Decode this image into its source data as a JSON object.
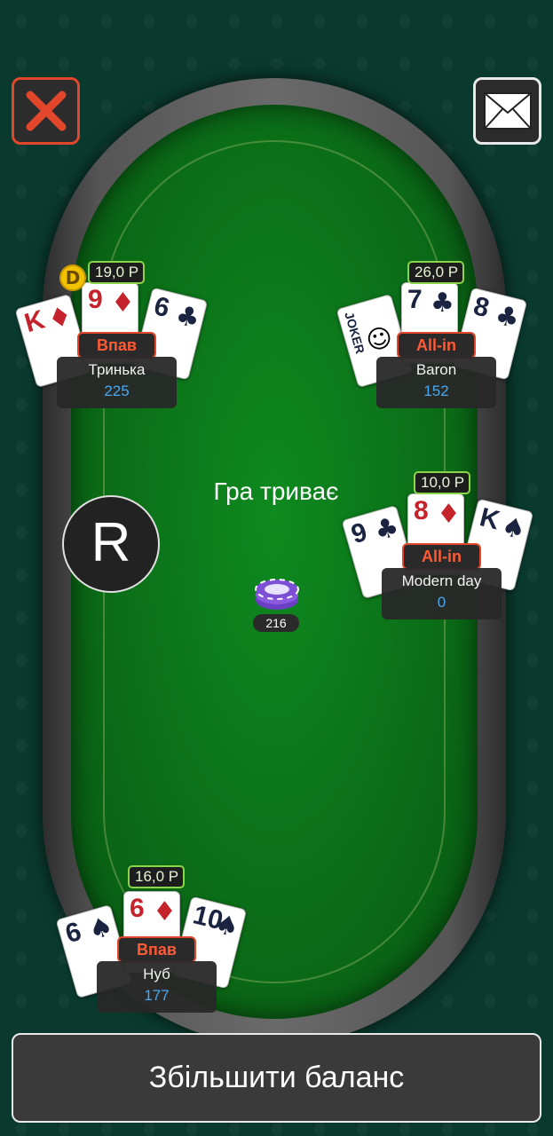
{
  "table": {
    "status_text": "Гра триває",
    "pot": "216",
    "r_button_label": "R"
  },
  "dealer_label": "D",
  "players": {
    "p1": {
      "name": "Тринька",
      "balance": "225",
      "bet": "19,0 Р",
      "status": "Впав",
      "cards": [
        {
          "rank": "K",
          "suit": "♦",
          "color": "red"
        },
        {
          "rank": "9",
          "suit": "♦",
          "color": "red"
        },
        {
          "rank": "6",
          "suit": "♣",
          "color": "black"
        }
      ]
    },
    "p2": {
      "name": "Baron",
      "balance": "152",
      "bet": "26,0 Р",
      "status": "All-in",
      "cards": [
        {
          "rank": "JOKER",
          "suit": "",
          "color": "black"
        },
        {
          "rank": "7",
          "suit": "♣",
          "color": "black"
        },
        {
          "rank": "8",
          "suit": "♣",
          "color": "black"
        }
      ]
    },
    "p3": {
      "name": "Modern day",
      "balance": "0",
      "bet": "10,0 Р",
      "status": "All-in",
      "cards": [
        {
          "rank": "9",
          "suit": "♣",
          "color": "black"
        },
        {
          "rank": "8",
          "suit": "♦",
          "color": "red"
        },
        {
          "rank": "K",
          "suit": "♠",
          "color": "black"
        }
      ]
    },
    "p4": {
      "name": "Нуб",
      "balance": "177",
      "bet": "16,0 Р",
      "status": "Впав",
      "cards": [
        {
          "rank": "6",
          "suit": "♠",
          "color": "black"
        },
        {
          "rank": "6",
          "suit": "♦",
          "color": "red"
        },
        {
          "rank": "10",
          "suit": "♠",
          "color": "black"
        }
      ]
    }
  },
  "buttons": {
    "add_balance": "Збільшити баланс",
    "close_icon": "close-icon",
    "mail_icon": "mail-icon"
  },
  "colors": {
    "accent_orange": "#e2472c",
    "bet_green": "#8bd44b",
    "balance_blue": "#4aa8f0",
    "felt_green": "#0b6e18"
  }
}
